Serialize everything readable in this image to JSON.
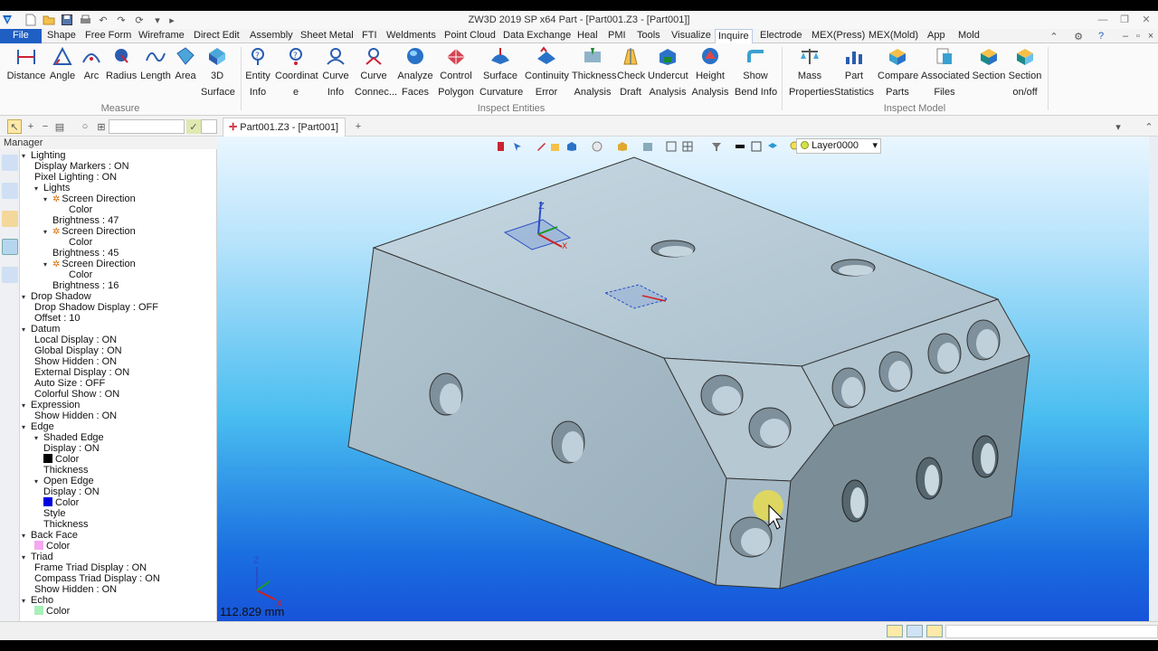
{
  "titlebar": {
    "title": "ZW3D 2019 SP x64        Part - [Part001.Z3 - [Part001]]"
  },
  "menu": {
    "file": "File",
    "tabs": [
      "Shape",
      "Free Form",
      "Wireframe",
      "Direct Edit",
      "Assembly",
      "Sheet Metal",
      "FTI",
      "Weldments",
      "Point Cloud",
      "Data Exchange",
      "Heal",
      "PMI",
      "Tools",
      "Visualize",
      "Inquire",
      "Electrode",
      "MEX(Press)",
      "MEX(Mold)",
      "App",
      "Mold"
    ],
    "active": "Inquire"
  },
  "ribbon": {
    "measure": {
      "label": "Measure",
      "buttons": [
        {
          "l1": "Distance",
          "l2": ""
        },
        {
          "l1": "Angle",
          "l2": ""
        },
        {
          "l1": "Arc",
          "l2": ""
        },
        {
          "l1": "Radius",
          "l2": ""
        },
        {
          "l1": "Length",
          "l2": ""
        },
        {
          "l1": "Area",
          "l2": ""
        },
        {
          "l1": "3D",
          "l2": "Surface"
        }
      ]
    },
    "inspect_entities": {
      "label": "Inspect Entities",
      "buttons": [
        {
          "l1": "Entity",
          "l2": "Info"
        },
        {
          "l1": "Coordinat",
          "l2": "e"
        },
        {
          "l1": "Curve",
          "l2": "Info"
        },
        {
          "l1": "Curve",
          "l2": "Connec..."
        },
        {
          "l1": "Analyze",
          "l2": "Faces"
        },
        {
          "l1": "Control",
          "l2": "Polygon"
        },
        {
          "l1": "Surface",
          "l2": "Curvature"
        },
        {
          "l1": "Continuity",
          "l2": "Error"
        },
        {
          "l1": "Thickness",
          "l2": "Analysis"
        },
        {
          "l1": "Check",
          "l2": "Draft"
        },
        {
          "l1": "Undercut",
          "l2": "Analysis"
        },
        {
          "l1": "Height",
          "l2": "Analysis"
        },
        {
          "l1": "Show",
          "l2": "Bend Info"
        }
      ]
    },
    "inspect_model": {
      "label": "Inspect Model",
      "buttons": [
        {
          "l1": "Mass",
          "l2": "Properties"
        },
        {
          "l1": "Part",
          "l2": "Statistics"
        },
        {
          "l1": "Compare",
          "l2": "Parts"
        },
        {
          "l1": "Associated",
          "l2": "Files"
        },
        {
          "l1": "Section",
          "l2": ""
        },
        {
          "l1": "Section",
          "l2": "on/off"
        }
      ]
    }
  },
  "doc_tab": {
    "label": "Part001.Z3 - [Part001]"
  },
  "manager": {
    "title": "Manager",
    "rows": [
      {
        "t": "Lighting",
        "lvl": 0,
        "exp": true
      },
      {
        "t": "Display Markers : ON",
        "lvl": 1
      },
      {
        "t": "Pixel Lighting : ON",
        "lvl": 1
      },
      {
        "t": "Lights",
        "lvl": 1,
        "exp": true
      },
      {
        "t": "Screen Direction",
        "lvl": 2,
        "exp": true,
        "sun": true
      },
      {
        "t": "Color",
        "lvl": 4
      },
      {
        "t": "Brightness : 47",
        "lvl": 3
      },
      {
        "t": "Screen Direction",
        "lvl": 2,
        "exp": true,
        "sun": true
      },
      {
        "t": "Color",
        "lvl": 4
      },
      {
        "t": "Brightness : 45",
        "lvl": 3
      },
      {
        "t": "Screen Direction",
        "lvl": 2,
        "exp": true,
        "sun": true
      },
      {
        "t": "Color",
        "lvl": 4
      },
      {
        "t": "Brightness : 16",
        "lvl": 3
      },
      {
        "t": "Drop Shadow",
        "lvl": 0,
        "exp": true
      },
      {
        "t": "Drop Shadow Display : OFF",
        "lvl": 1
      },
      {
        "t": "Offset : 10",
        "lvl": 1
      },
      {
        "t": "Datum",
        "lvl": 0,
        "exp": true
      },
      {
        "t": "Local Display : ON",
        "lvl": 1
      },
      {
        "t": "Global Display : ON",
        "lvl": 1
      },
      {
        "t": "Show Hidden : ON",
        "lvl": 1
      },
      {
        "t": "External Display : ON",
        "lvl": 1
      },
      {
        "t": "Auto Size : OFF",
        "lvl": 1
      },
      {
        "t": "Colorful Show : ON",
        "lvl": 1
      },
      {
        "t": "Expression",
        "lvl": 0,
        "exp": true
      },
      {
        "t": "Show Hidden : ON",
        "lvl": 1
      },
      {
        "t": "Edge",
        "lvl": 0,
        "exp": true
      },
      {
        "t": "Shaded Edge",
        "lvl": 1,
        "exp": true
      },
      {
        "t": "Display : ON",
        "lvl": 2
      },
      {
        "t": "Color",
        "lvl": 2,
        "swatch": "#000000"
      },
      {
        "t": "Thickness",
        "lvl": 2
      },
      {
        "t": "Open Edge",
        "lvl": 1,
        "exp": true
      },
      {
        "t": "Display : ON",
        "lvl": 2
      },
      {
        "t": "Color",
        "lvl": 2,
        "swatch": "#0000e0"
      },
      {
        "t": "Style",
        "lvl": 2
      },
      {
        "t": "Thickness",
        "lvl": 2
      },
      {
        "t": "Back Face",
        "lvl": 0,
        "exp": true
      },
      {
        "t": "Color",
        "lvl": 1,
        "swatch": "#f5a8f0"
      },
      {
        "t": "Triad",
        "lvl": 0,
        "exp": true
      },
      {
        "t": "Frame Triad Display : ON",
        "lvl": 1
      },
      {
        "t": "Compass Triad Display : ON",
        "lvl": 1
      },
      {
        "t": "Show Hidden : ON",
        "lvl": 1
      },
      {
        "t": "Echo",
        "lvl": 0,
        "exp": true
      },
      {
        "t": "Color",
        "lvl": 1,
        "swatch": "#a8f0b8"
      }
    ]
  },
  "viewport": {
    "layer": "Layer0000",
    "scale_text": "112.829 mm",
    "triad": {
      "z": "Z",
      "x": "X"
    }
  },
  "colors": {
    "accent": "#1f5fc4",
    "part_top": "#b9cbd6",
    "part_front": "#a9bfcc",
    "part_side": "#7f929c"
  }
}
